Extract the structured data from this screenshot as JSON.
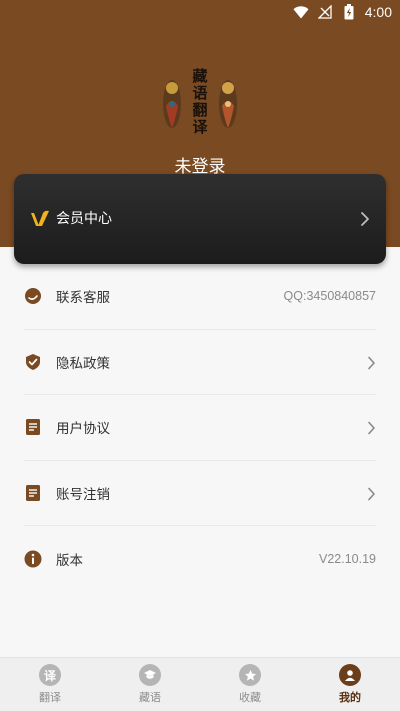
{
  "status_bar": {
    "time": "4:00"
  },
  "logo": {
    "text": [
      "藏",
      "语",
      "翻",
      "译"
    ]
  },
  "profile": {
    "login_status": "未登录"
  },
  "vip": {
    "label": "会员中心"
  },
  "menu": [
    {
      "id": "contact",
      "label": "联系客服",
      "value": "QQ:3450840857",
      "icon": "chat-bubble-icon"
    },
    {
      "id": "privacy",
      "label": "隐私政策",
      "icon": "shield-check-icon"
    },
    {
      "id": "agreement",
      "label": "用户协议",
      "icon": "document-icon"
    },
    {
      "id": "account-cancel",
      "label": "账号注销",
      "icon": "document-icon"
    },
    {
      "id": "version",
      "label": "版本",
      "value": "V22.10.19",
      "icon": "info-icon"
    }
  ],
  "tabs": [
    {
      "label": "翻译",
      "glyph": "译",
      "icon": "translate-icon"
    },
    {
      "label": "藏语",
      "icon": "graduation-cap-icon"
    },
    {
      "label": "收藏",
      "icon": "star-icon"
    },
    {
      "label": "我的",
      "icon": "user-icon",
      "active": true
    }
  ],
  "colors": {
    "brand": "#7a4a22",
    "icon_brown": "#7a4a22",
    "active_tab": "#6b3e1b"
  }
}
